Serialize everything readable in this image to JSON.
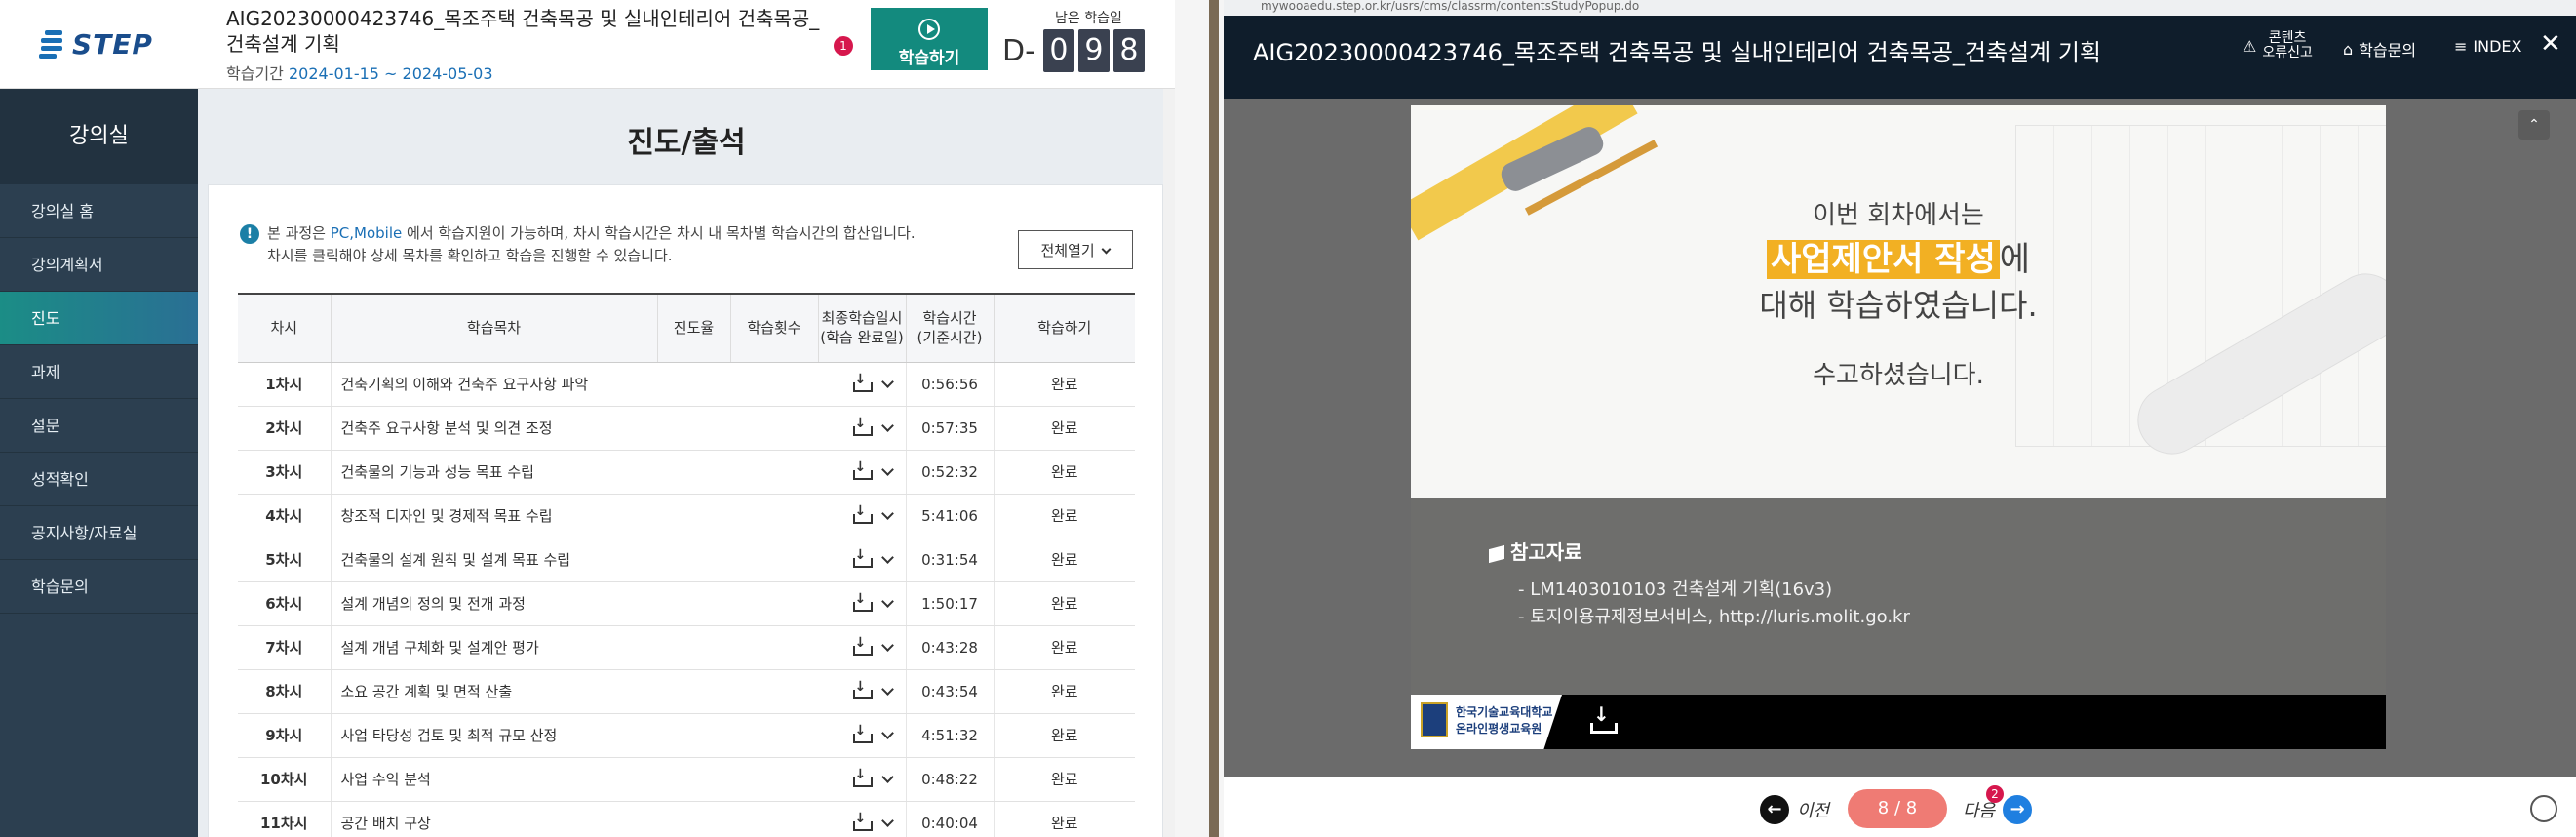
{
  "left": {
    "logo_text": "STEP",
    "course_title": "AIG20230000423746_목조주택 건축목공 및 실내인테리어 건축목공_건축설계 기획",
    "period_label": "학습기간",
    "period_value": "2024-01-15 ~ 2024-05-03",
    "notification_count": "1",
    "study_button": "학습하기",
    "remaining_label": "남은 학습일",
    "dday_prefix": "D-",
    "dday_digits": [
      "0",
      "9",
      "8"
    ],
    "sidebar_title": "강의실",
    "sidebar_items": [
      "강의실 홈",
      "강의계획서",
      "진도",
      "과제",
      "설문",
      "성적확인",
      "공지사항/자료실",
      "학습문의"
    ],
    "active_item": "진도",
    "page_title": "진도/출석",
    "notice_line1_pre": "본 과정은 ",
    "notice_line1_blue": "PC,Mobile",
    "notice_line1_post": " 에서 학습지원이 가능하며, 차시 학습시간은 차시 내 목차별 학습시간의 합산입니다.",
    "notice_line2": "차시를 클릭해야 상세 목차를 확인하고 학습을 진행할 수 있습니다.",
    "open_all_button": "전체열기",
    "table_headers": [
      "차시",
      "학습목차",
      "진도율",
      "학습횟수",
      "최종학습일시\n(학습 완료일)",
      "학습시간\n(기준시간)",
      "학습하기"
    ],
    "rows": [
      {
        "session": "1차시",
        "title": "건축기획의 이해와 건축주 요구사항 파악",
        "time": "0:56:56",
        "status": "완료"
      },
      {
        "session": "2차시",
        "title": "건축주 요구사항 분석 및 의견 조정",
        "time": "0:57:35",
        "status": "완료"
      },
      {
        "session": "3차시",
        "title": "건축물의 기능과 성능 목표 수립",
        "time": "0:52:32",
        "status": "완료"
      },
      {
        "session": "4차시",
        "title": "창조적 디자인 및 경제적 목표 수립",
        "time": "5:41:06",
        "status": "완료"
      },
      {
        "session": "5차시",
        "title": "건축물의 설계 원칙 및 설계 목표 수립",
        "time": "0:31:54",
        "status": "완료"
      },
      {
        "session": "6차시",
        "title": "설계 개념의 정의 및 전개 과정",
        "time": "1:50:17",
        "status": "완료"
      },
      {
        "session": "7차시",
        "title": "설계 개념 구체화 및 설계안 평가",
        "time": "0:43:28",
        "status": "완료"
      },
      {
        "session": "8차시",
        "title": "소요 공간 계획 및 면적 산출",
        "time": "0:43:54",
        "status": "완료"
      },
      {
        "session": "9차시",
        "title": "사업 타당성 검토 및 최적 규모 산정",
        "time": "4:51:32",
        "status": "완료"
      },
      {
        "session": "10차시",
        "title": "사업 수익 분석",
        "time": "0:48:22",
        "status": "완료"
      },
      {
        "session": "11차시",
        "title": "공간 배치 구상",
        "time": "0:40:04",
        "status": "완료"
      }
    ]
  },
  "right": {
    "url": "mywooaedu.step.or.kr/usrs/cms/classrm/contentsStudyPopup.do",
    "player_title": "AIG20230000423746_목조주택 건축목공 및 실내인테리어 건축목공_건축설계 기획",
    "menu_report": "콘텐츠\n오류신고",
    "menu_inquiry": "학습문의",
    "menu_index": "INDEX",
    "close": "✕",
    "slide_msg1": "이번 회차에서는",
    "slide_msg2_hl": "사업제안서 작성",
    "slide_msg2_post": "에",
    "slide_msg3": "대해 학습하였습니다.",
    "slide_msg4": "수고하셨습니다.",
    "ref_title": "참고자료",
    "ref_items": [
      "- LM1403010103 건축설계 기획(16v3)",
      "- 토지이용규제정보서비스, http://luris.molit.go.kr"
    ],
    "foot_org_line1": "한국기술교육대학교",
    "foot_org_line2": "온라인평생교육원",
    "prev_label": "이전",
    "page_indicator": "8 / 8",
    "next_label": "다음",
    "next_badge": "2"
  }
}
